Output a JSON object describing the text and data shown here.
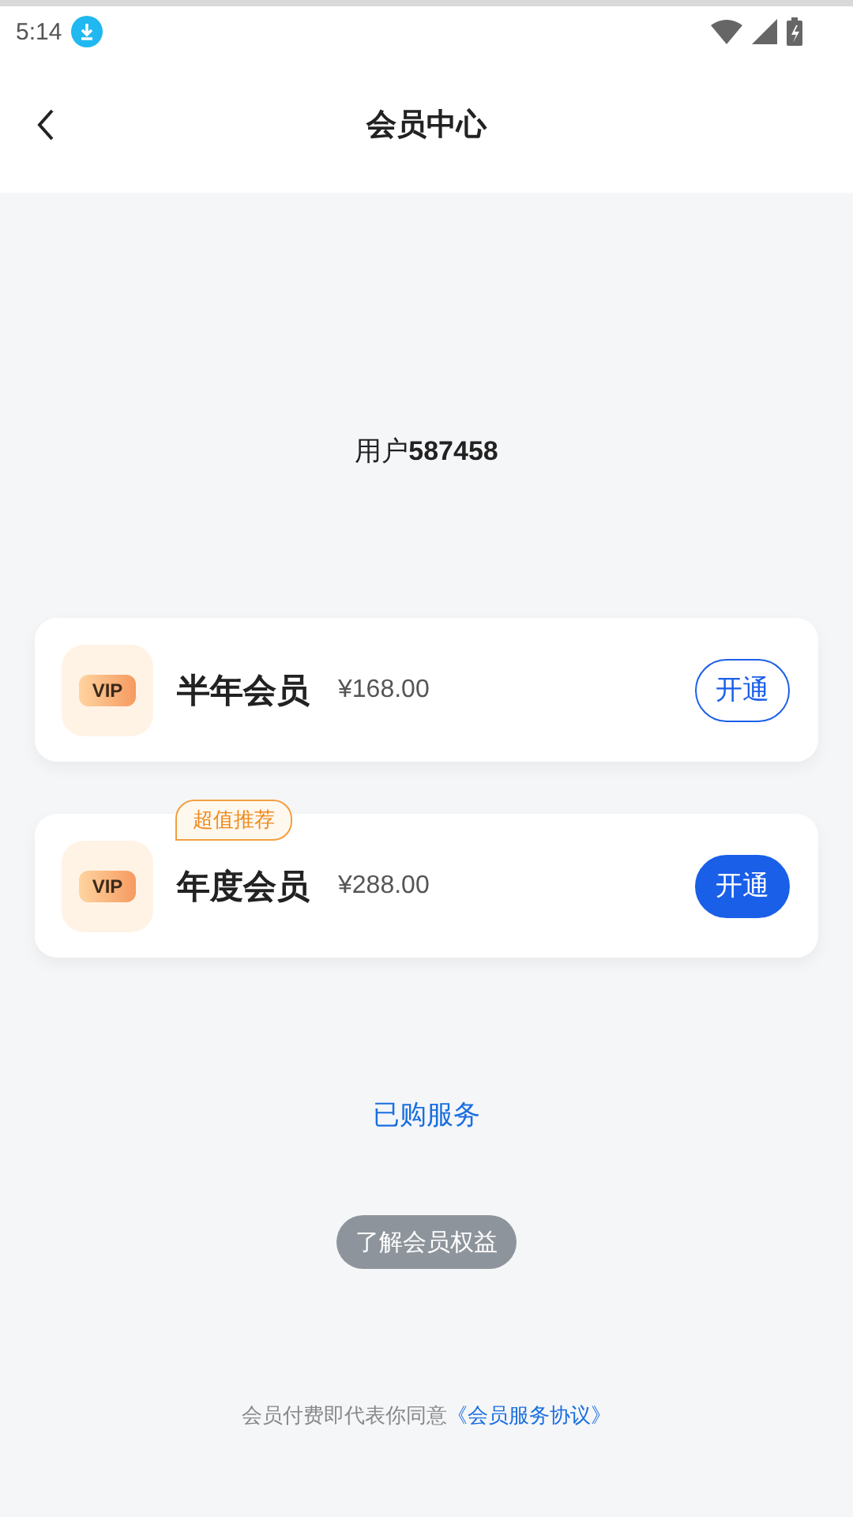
{
  "status_bar": {
    "time": "5:14"
  },
  "header": {
    "title": "会员中心"
  },
  "user": {
    "label": "用户",
    "id": "587458"
  },
  "plans": [
    {
      "name": "半年会员",
      "price": "¥168.00",
      "badge_icon": "VIP",
      "action": "开通",
      "selected": false
    },
    {
      "name": "年度会员",
      "price": "¥288.00",
      "badge_icon": "VIP",
      "action": "开通",
      "selected": true,
      "tag": "超值推荐"
    }
  ],
  "purchased_link": "已购服务",
  "benefits_button": "了解会员权益",
  "footer": {
    "text": "会员付费即代表你同意",
    "link": "《会员服务协议》"
  }
}
